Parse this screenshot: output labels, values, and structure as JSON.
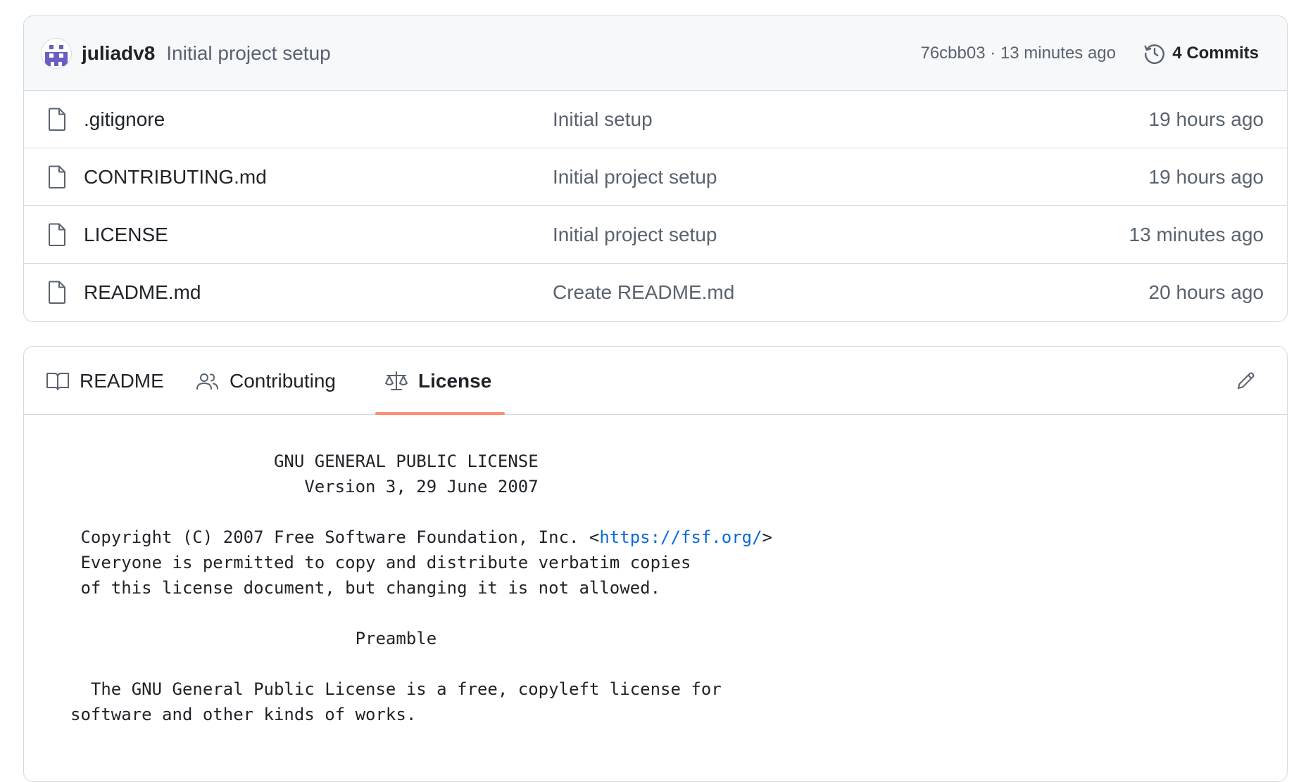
{
  "latest_commit": {
    "author": "juliadv8",
    "message": "Initial project setup",
    "hash": "76cbb03",
    "separator": " · ",
    "time": "13 minutes ago",
    "commits_label": "4 Commits"
  },
  "files": [
    {
      "name": ".gitignore",
      "commit": "Initial setup",
      "age": "19 hours ago",
      "icon": "file-icon"
    },
    {
      "name": "CONTRIBUTING.md",
      "commit": "Initial project setup",
      "age": "19 hours ago",
      "icon": "file-icon"
    },
    {
      "name": "LICENSE",
      "commit": "Initial project setup",
      "age": "13 minutes ago",
      "icon": "file-icon"
    },
    {
      "name": "README.md",
      "commit": "Create README.md",
      "age": "20 hours ago",
      "icon": "file-icon"
    }
  ],
  "tabs": [
    {
      "label": "README",
      "icon": "book-icon",
      "active": false
    },
    {
      "label": "Contributing",
      "icon": "people-icon",
      "active": false
    },
    {
      "label": "License",
      "icon": "law-icon",
      "active": true
    }
  ],
  "license": {
    "title_line": "                    GNU GENERAL PUBLIC LICENSE",
    "version_line": "                       Version 3, 29 June 2007",
    "copyright_prefix": " Copyright (C) 2007 Free Software Foundation, Inc. <",
    "copyright_link": "https://fsf.org/",
    "copyright_suffix": ">",
    "line_everyone": " Everyone is permitted to copy and distribute verbatim copies",
    "line_of_this": " of this license document, but changing it is not allowed.",
    "preamble": "                            Preamble",
    "para_line1": "  The GNU General Public License is a free, copyleft license for",
    "para_line2": "software and other kinds of works."
  },
  "colors": {
    "accent_underline": "#fd8c73",
    "link": "#0969da",
    "muted_text": "#59636e",
    "border": "#d1d9e0"
  }
}
